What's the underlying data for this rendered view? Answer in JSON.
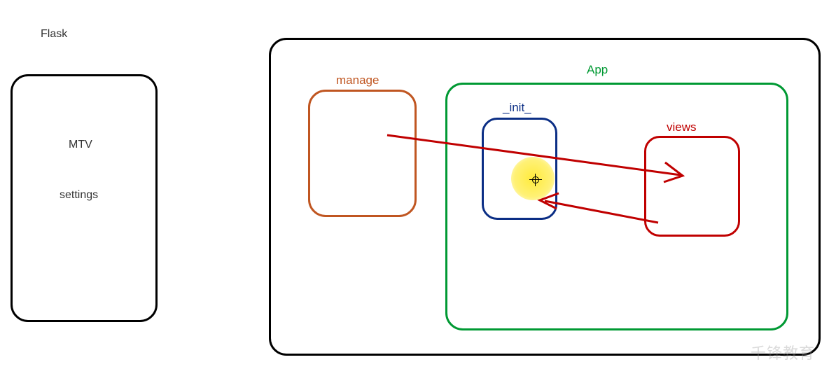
{
  "diagram": {
    "title": "Flask",
    "leftBox": {
      "labels": {
        "mtv": "MTV",
        "settings": "settings"
      }
    },
    "mainBox": {
      "manage": {
        "label": "manage"
      },
      "app": {
        "label": "App",
        "init": {
          "label": "_init_"
        },
        "views": {
          "label": "views"
        }
      }
    },
    "arrows": [
      {
        "from": "manage",
        "to": "views",
        "color": "#c00000"
      },
      {
        "from": "views",
        "to": "init",
        "color": "#c00000"
      }
    ]
  },
  "watermark": "千锋教育"
}
